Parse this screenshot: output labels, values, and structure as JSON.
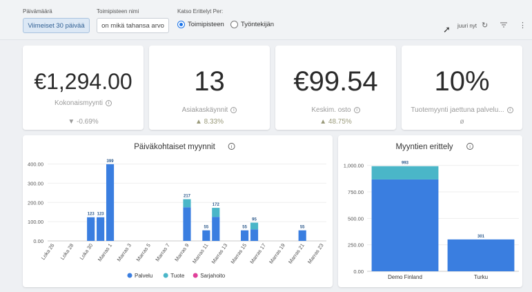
{
  "filters": {
    "date_label": "Päivämäärä",
    "date_value": "Viimeiset 30 päivää",
    "store_label": "Toimipisteen nimi",
    "store_value": "on mikä tahansa arvo",
    "breakdown_label": "Katso Erittelyt Per:",
    "radio_store": "Toimipisteen",
    "radio_employee": "Työntekijän",
    "selected": "Toimipisteen"
  },
  "toolbar": {
    "updated": "juuri nyt",
    "icons": [
      "refresh-icon",
      "filter-icon",
      "more-vertical-icon"
    ]
  },
  "kpis": [
    {
      "value": "€1,294.00",
      "label": "Kokonaismyynti",
      "delta": "▼ -0.69%"
    },
    {
      "value": "13",
      "label": "Asiakaskäynnit",
      "delta": "▲ 8.33%"
    },
    {
      "value": "€99.54",
      "label": "Keskim. osto",
      "delta": "▲ 48.75%"
    },
    {
      "value": "10%",
      "label": "Tuotemyynti jaettuna palvelu...",
      "delta": "ø"
    }
  ],
  "colors": {
    "palvelu": "#3a7ee0",
    "tuote": "#4ab6c8",
    "sarjahoito": "#e0409a"
  },
  "chart_data": [
    {
      "type": "bar",
      "title": "Päiväkohtaiset myynnit",
      "categories": [
        "Loka 26",
        "Loka 27",
        "Loka 28",
        "Loka 29",
        "Loka 30",
        "Loka 31",
        "Marras 1",
        "Marras 2",
        "Marras 3",
        "Marras 4",
        "Marras 5",
        "Marras 6",
        "Marras 7",
        "Marras 8",
        "Marras 9",
        "Marras 10",
        "Marras 11",
        "Marras 12",
        "Marras 13",
        "Marras 14",
        "Marras 15",
        "Marras 16",
        "Marras 17",
        "Marras 18",
        "Marras 19",
        "Marras 20",
        "Marras 21",
        "Marras 22",
        "Marras 23"
      ],
      "tick_labels": [
        "Loka 26",
        "Loka 28",
        "Loka 30",
        "Marras 1",
        "Marras 3",
        "Marras 5",
        "Marras 7",
        "Marras 9",
        "Marras 11",
        "Marras 13",
        "Marras 15",
        "Marras 17",
        "Marras 19",
        "Marras 21",
        "Marras 23"
      ],
      "series": [
        {
          "name": "Palvelu",
          "values": [
            0,
            0,
            0,
            0,
            123,
            123,
            399,
            0,
            0,
            0,
            0,
            0,
            0,
            0,
            175,
            0,
            55,
            125,
            0,
            0,
            55,
            60,
            0,
            0,
            0,
            0,
            55,
            0,
            0
          ]
        },
        {
          "name": "Tuote",
          "values": [
            0,
            0,
            0,
            0,
            0,
            0,
            0,
            0,
            0,
            0,
            0,
            0,
            0,
            0,
            42,
            0,
            0,
            47,
            0,
            0,
            0,
            35,
            0,
            0,
            0,
            0,
            0,
            0,
            0
          ]
        },
        {
          "name": "Sarjahoito",
          "values": [
            0,
            0,
            0,
            0,
            0,
            0,
            0,
            0,
            0,
            0,
            0,
            0,
            0,
            0,
            0,
            0,
            0,
            0,
            0,
            0,
            0,
            0,
            0,
            0,
            0,
            0,
            0,
            0,
            0
          ]
        }
      ],
      "totals": [
        null,
        null,
        null,
        null,
        123,
        123,
        399,
        null,
        null,
        null,
        null,
        null,
        null,
        null,
        217,
        null,
        55,
        172,
        null,
        null,
        55,
        95,
        null,
        null,
        null,
        null,
        55,
        null,
        null
      ],
      "yticks": [
        "0.00",
        "100.00",
        "200.00",
        "300.00",
        "400.00"
      ],
      "ylim": [
        0,
        420
      ],
      "stacked": true,
      "legend": "bottom"
    },
    {
      "type": "bar",
      "title": "Myyntien erittely",
      "categories": [
        "Demo Finland",
        "Turku"
      ],
      "series": [
        {
          "name": "Palvelu",
          "values": [
            868,
            301
          ]
        },
        {
          "name": "Tuote",
          "values": [
            125,
            0
          ]
        }
      ],
      "totals": [
        993,
        301
      ],
      "yticks": [
        "0.00",
        "250.00",
        "500.00",
        "750.00",
        "1,000.00"
      ],
      "ylim": [
        0,
        1050
      ],
      "stacked": true
    }
  ]
}
